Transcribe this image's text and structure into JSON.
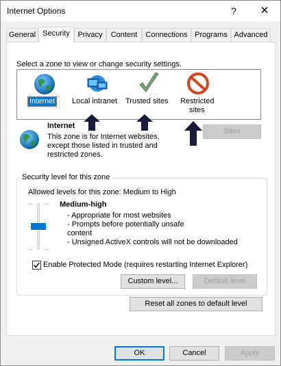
{
  "window": {
    "title": "Internet Options",
    "help_glyph": "?",
    "close_glyph": "✕"
  },
  "tabs": [
    {
      "label": "General"
    },
    {
      "label": "Security",
      "active": true
    },
    {
      "label": "Privacy"
    },
    {
      "label": "Content"
    },
    {
      "label": "Connections"
    },
    {
      "label": "Programs"
    },
    {
      "label": "Advanced"
    }
  ],
  "security": {
    "zone_prompt": "Select a zone to view or change security settings.",
    "zones": [
      {
        "label": "Internet",
        "icon": "globe-icon",
        "selected": true
      },
      {
        "label": "Local intranet",
        "icon": "intranet-icon"
      },
      {
        "label": "Trusted sites",
        "icon": "checkmark-icon"
      },
      {
        "label_line1": "Restricted",
        "label_line2": "sites",
        "icon": "restricted-icon"
      }
    ],
    "zone_info": {
      "title": "Internet",
      "desc_line1": "This zone is for Internet websites,",
      "desc_line2": "except those listed in trusted and",
      "desc_line3": "restricted zones."
    },
    "sites_button": "Sites",
    "level_group_title": "Security level for this zone",
    "allowed_levels": "Allowed levels for this zone: Medium to High",
    "level_name": "Medium-high",
    "level_desc": [
      "- Appropriate for most websites",
      "- Prompts before potentially unsafe",
      "content",
      "- Unsigned ActiveX controls will not be downloaded"
    ],
    "protected_mode_label": "Enable Protected Mode (requires restarting Internet Explorer)",
    "protected_mode_checked": true,
    "custom_level_button": "Custom level...",
    "default_level_button": "Default level",
    "reset_all_button": "Reset all zones to default level"
  },
  "footer": {
    "ok": "OK",
    "cancel": "Cancel",
    "apply": "Apply"
  },
  "colors": {
    "accent": "#0078d7",
    "arrow": "#1a1a3c"
  }
}
